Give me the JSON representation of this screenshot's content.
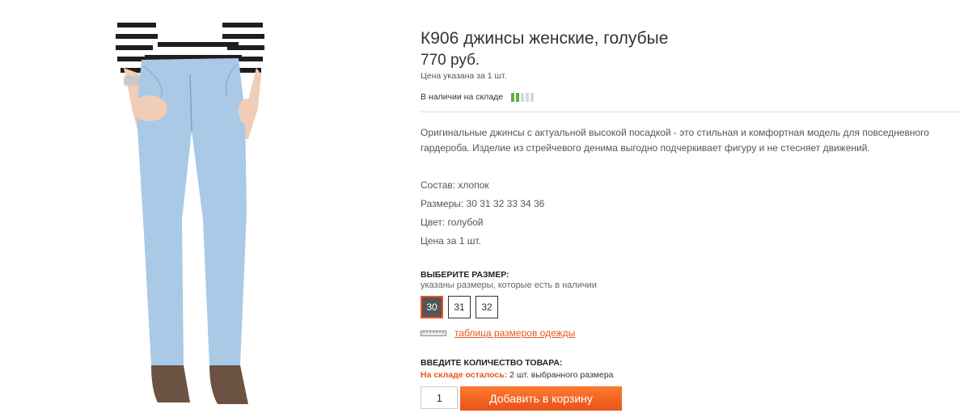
{
  "product": {
    "title": "К906 джинсы женские, голубые",
    "price": "770 руб.",
    "price_note": "Цена указана за 1 шт.",
    "stock_label": "В наличии на складе",
    "stock_level": 2,
    "stock_max": 5,
    "description": "Оригинальные джинсы с актуальной высокой посадкой - это стильная и комфортная модель для повседневного гардероба. Изделие из стрейчевого денима выгодно подчеркивает фигуру и не стесняет движений.",
    "attributes": {
      "material": "Состав: хлопок",
      "sizes": "Размеры: 30 31 32 33 34 36",
      "color": "Цвет: голубой",
      "price_per": "Цена за 1 шт."
    }
  },
  "size_select": {
    "heading": "ВЫБЕРИТЕ РАЗМЕР:",
    "hint": "указаны размеры, которые есть в наличии",
    "options": [
      "30",
      "31",
      "32"
    ],
    "selected": "30",
    "size_chart_link": "таблица размеров одежды"
  },
  "quantity": {
    "heading": "ВВЕДИТЕ КОЛИЧЕСТВО ТОВАРА:",
    "stock_warn": "На складе осталось:",
    "stock_rest": " 2 шт. выбранного размера",
    "value": "1",
    "add_button": "Добавить в корзину"
  },
  "colors": {
    "accent": "#e8571a",
    "stock_bar": "#5fb13a"
  }
}
